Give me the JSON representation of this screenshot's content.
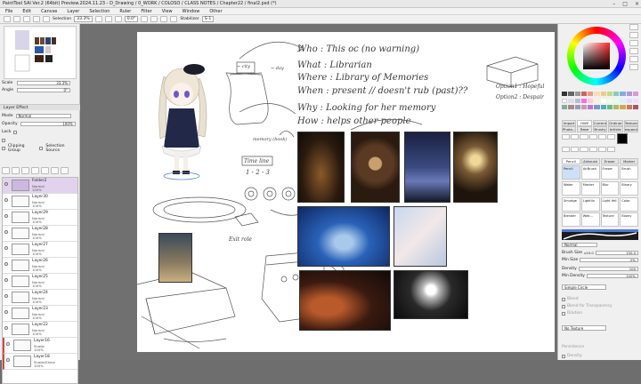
{
  "window": {
    "title": "PaintTool SAI Ver.2 (64bit) Preview.2024.11.23 - D_Drawing / 0_WORK / COLOSO / CLASS NOTES / Chapter22 / final2.psd (*)",
    "controls": [
      "–",
      "□",
      "×"
    ]
  },
  "menu": [
    "File",
    "Edit",
    "Canvas",
    "Layer",
    "Selection",
    "Ruler",
    "Filter",
    "View",
    "Window",
    "Other"
  ],
  "toolbar": {
    "selection_label": "Selection",
    "zoom": "33.3%",
    "angle": "0.0°",
    "stabilizer_label": "Stabilizer",
    "stabilizer_value": "S-1"
  },
  "navigator": {
    "scale_label": "Scale",
    "scale_value": "33.3%",
    "angle_label": "Angle",
    "angle_value": "0°"
  },
  "layer_effect": {
    "section": "Layer Effect",
    "mode_label": "Mode",
    "mode_value": "Normal",
    "opacity_label": "Opacity",
    "opacity_value": "100%",
    "lock_label": "Lock",
    "clipping_group": "Clipping Group",
    "selection_source": "Selection Source"
  },
  "layers": [
    {
      "name": "Folder2",
      "mode": "Normal",
      "opacity": "100%",
      "type": "folder"
    },
    {
      "name": "Layer30",
      "mode": "Normal",
      "opacity": "100%",
      "type": "layer"
    },
    {
      "name": "Layer29",
      "mode": "Normal",
      "opacity": "100%",
      "type": "layer"
    },
    {
      "name": "Layer28",
      "mode": "Normal",
      "opacity": "100%",
      "type": "layer"
    },
    {
      "name": "Layer27",
      "mode": "Normal",
      "opacity": "100%",
      "type": "layer"
    },
    {
      "name": "Layer26",
      "mode": "Normal",
      "opacity": "100%",
      "type": "layer"
    },
    {
      "name": "Layer25",
      "mode": "Normal",
      "opacity": "100%",
      "type": "layer"
    },
    {
      "name": "Layer24",
      "mode": "Normal",
      "opacity": "100%",
      "type": "layer"
    },
    {
      "name": "Layer23",
      "mode": "Normal",
      "opacity": "100%",
      "type": "layer"
    },
    {
      "name": "Layer22",
      "mode": "Normal",
      "opacity": "100%",
      "type": "layer"
    },
    {
      "name": "Layer16",
      "mode": "Shade",
      "opacity": "100%",
      "type": "red"
    },
    {
      "name": "Layer18",
      "mode": "Shade/Shine",
      "opacity": "100%",
      "type": "red"
    }
  ],
  "notes": {
    "who": "Who : This oc (no warning)",
    "what": "What : Librarian",
    "where": "Where : Library of Memories",
    "when": "When : present // doesn't rub (past)??",
    "why": "Why : Looking for her memory",
    "how": "How : helps other people",
    "option1": "Option1 : Hopeful",
    "option2": "Option2 : Despair",
    "sketch1": "~ city",
    "sketch2": "~ day",
    "memory": "memory (book)",
    "timeline": "Time line",
    "countdown": "1 - 2 - 3",
    "exit": "Exit role"
  },
  "right_panel": {
    "tabs1": [
      "Import",
      "HWE",
      "Current",
      "Ordinar",
      "Texture"
    ],
    "tabs2": [
      "Photo...",
      "Base",
      "Brushy",
      "Artistic",
      "expand"
    ],
    "tool_tabs": [
      "Pencil",
      "Airbrush",
      "Eraser",
      "Marker"
    ],
    "brushes": [
      "Pencil",
      "AirBrush",
      "Eraser",
      "Brush",
      "Water",
      "Marker",
      "Blur",
      "Binary",
      "Smudge",
      "Lightlin",
      "Light Yell",
      "Color",
      "Blender",
      "Web...",
      "Texture",
      "Ebony",
      "Water",
      "Flat Pen",
      "Flat Pen",
      "Flat Pen"
    ],
    "blend_mode": "Normal",
    "brush_size_label": "Brush Size",
    "brush_size_mult": "x10.0",
    "brush_size_value": "150.0",
    "min_size_label": "Min Size",
    "min_size_value": "0%",
    "density_label": "Density",
    "density_value": "100",
    "min_density_label": "Min Density",
    "min_density_value": "100%",
    "brush_shape": "Simple Circle",
    "blend_label": "Blend",
    "blend_opt1": "Blend for Transparency",
    "blend_opt2": "Dilution",
    "texture": "No Texture",
    "persistence_label": "Persistence",
    "density_sub": "Density"
  },
  "colors": {
    "accent": "#4a7bd6",
    "folder_highlight": "#e2d2ee",
    "marker": "#d04a4a"
  }
}
